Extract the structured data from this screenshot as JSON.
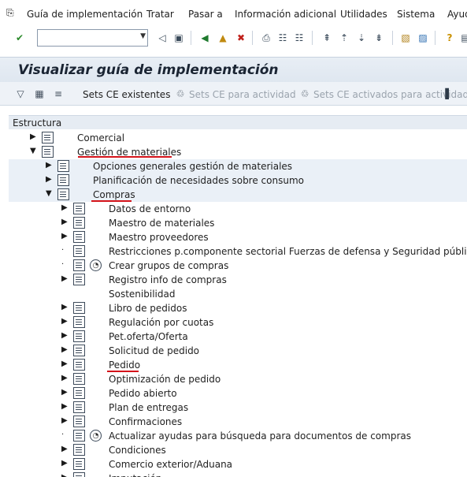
{
  "menu": {
    "items": [
      "Guía de implementación",
      "Tratar",
      "Pasar a",
      "Información adicional",
      "Utilidades",
      "Sistema",
      "Ayud"
    ]
  },
  "title": "Visualizar guía de implementación",
  "app_toolbar": {
    "sets_existing": "Sets CE existentes",
    "sets_activity": "Sets CE para actividad",
    "sets_activated": "Sets CE activados para actividad"
  },
  "tree": {
    "header": "Estructura",
    "level1": [
      "Comercial",
      "Gestión de materiales"
    ],
    "level2": [
      "Opciones generales gestión de materiales",
      "Planificación de necesidades sobre consumo",
      "Compras"
    ],
    "level3": [
      "Datos de entorno",
      "Maestro de materiales",
      "Maestro proveedores",
      "Restricciones p.componente sectorial Fuerzas de defensa y Seguridad pública",
      "Crear grupos de compras",
      "Registro info de compras",
      "Sostenibilidad",
      "Libro de pedidos",
      "Regulación por cuotas",
      "Pet.oferta/Oferta",
      "Solicitud de pedido",
      "Pedido",
      "Optimización de pedido",
      "Pedido abierto",
      "Plan de entregas",
      "Confirmaciones",
      "Actualizar ayudas para búsqueda para documentos de compras",
      "Condiciones",
      "Comercio exterior/Aduana",
      "Imputación"
    ]
  },
  "colors": {
    "underline": "#d4131a",
    "accent": "#1a2433"
  }
}
